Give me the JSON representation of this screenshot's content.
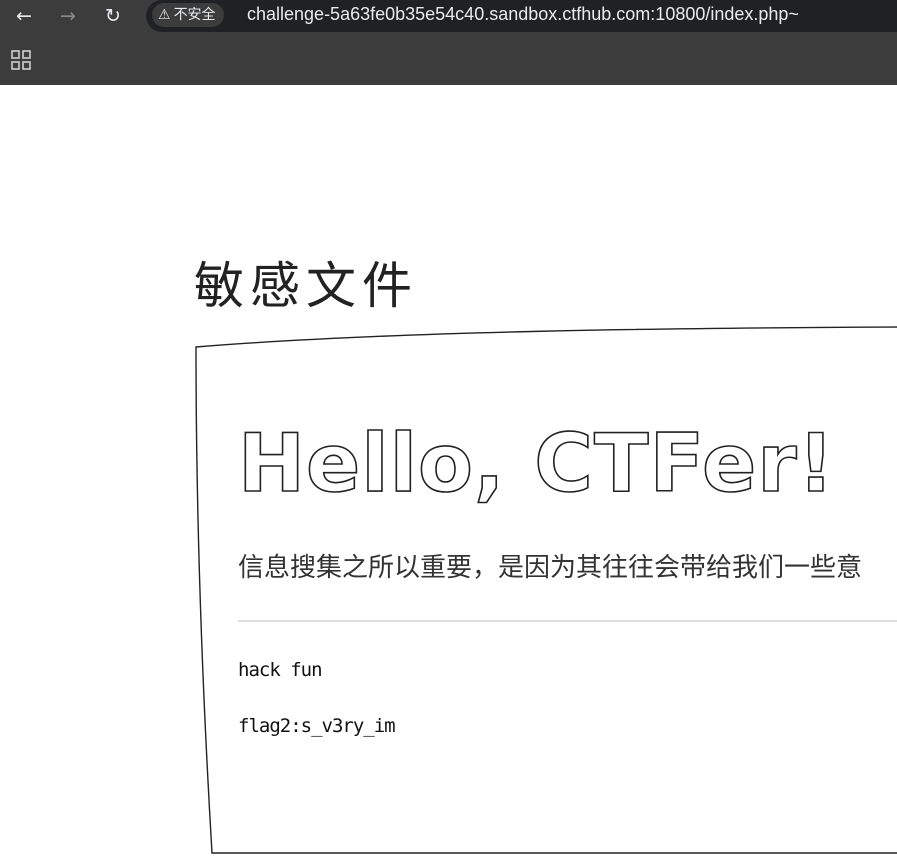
{
  "browser": {
    "back_icon": "←",
    "forward_icon": "→",
    "reload_icon": "↻",
    "security_warning_icon": "⚠",
    "security_label": "不安全",
    "url": "challenge-5a63fe0b35e54c40.sandbox.ctfhub.com:10800/index.php~"
  },
  "page": {
    "title": "敏感文件",
    "hero": "Hello, CTFer!",
    "lead": "信息搜集之所以重要，是因为其往往会带给我们一些意",
    "paragraphs": [
      "hack fun",
      "flag2:s_v3ry_im"
    ]
  }
}
